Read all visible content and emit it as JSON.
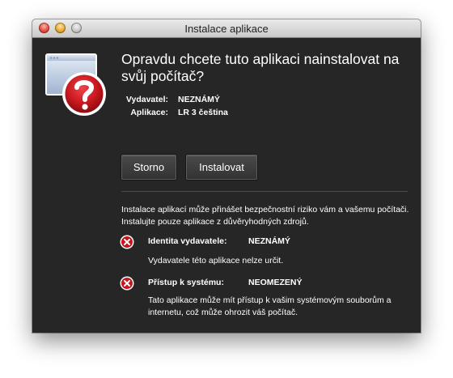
{
  "window": {
    "title": "Instalace aplikace"
  },
  "dialog": {
    "question": "Opravdu chcete tuto aplikaci nainstalovat na svůj počítač?",
    "publisher_label": "Vydavatel:",
    "publisher_value": "NEZNÁMÝ",
    "application_label": "Aplikace:",
    "application_value": "LR 3 čeština"
  },
  "buttons": {
    "cancel_label": "Storno",
    "install_label": "Instalovat"
  },
  "warning": {
    "text": "Instalace aplikací může přinášet bezpečnostní riziko vám a vašemu počítači. Instalujte pouze aplikace z důvěryhodných zdrojů."
  },
  "risks": [
    {
      "label": "Identita vydavatele:",
      "value": "NEZNÁMÝ",
      "description": "Vydavatele této aplikace nelze určit.",
      "icon": "error-x-icon"
    },
    {
      "label": "Přístup k systému:",
      "value": "NEOMEZENÝ",
      "description": "Tato aplikace může mít přístup k vašim systémovým souborům a internetu, což může ohrozit váš počítač.",
      "icon": "error-x-icon"
    }
  ],
  "colors": {
    "dialog_background": "#262626",
    "error_red": "#c4161c",
    "text": "#ffffff"
  }
}
